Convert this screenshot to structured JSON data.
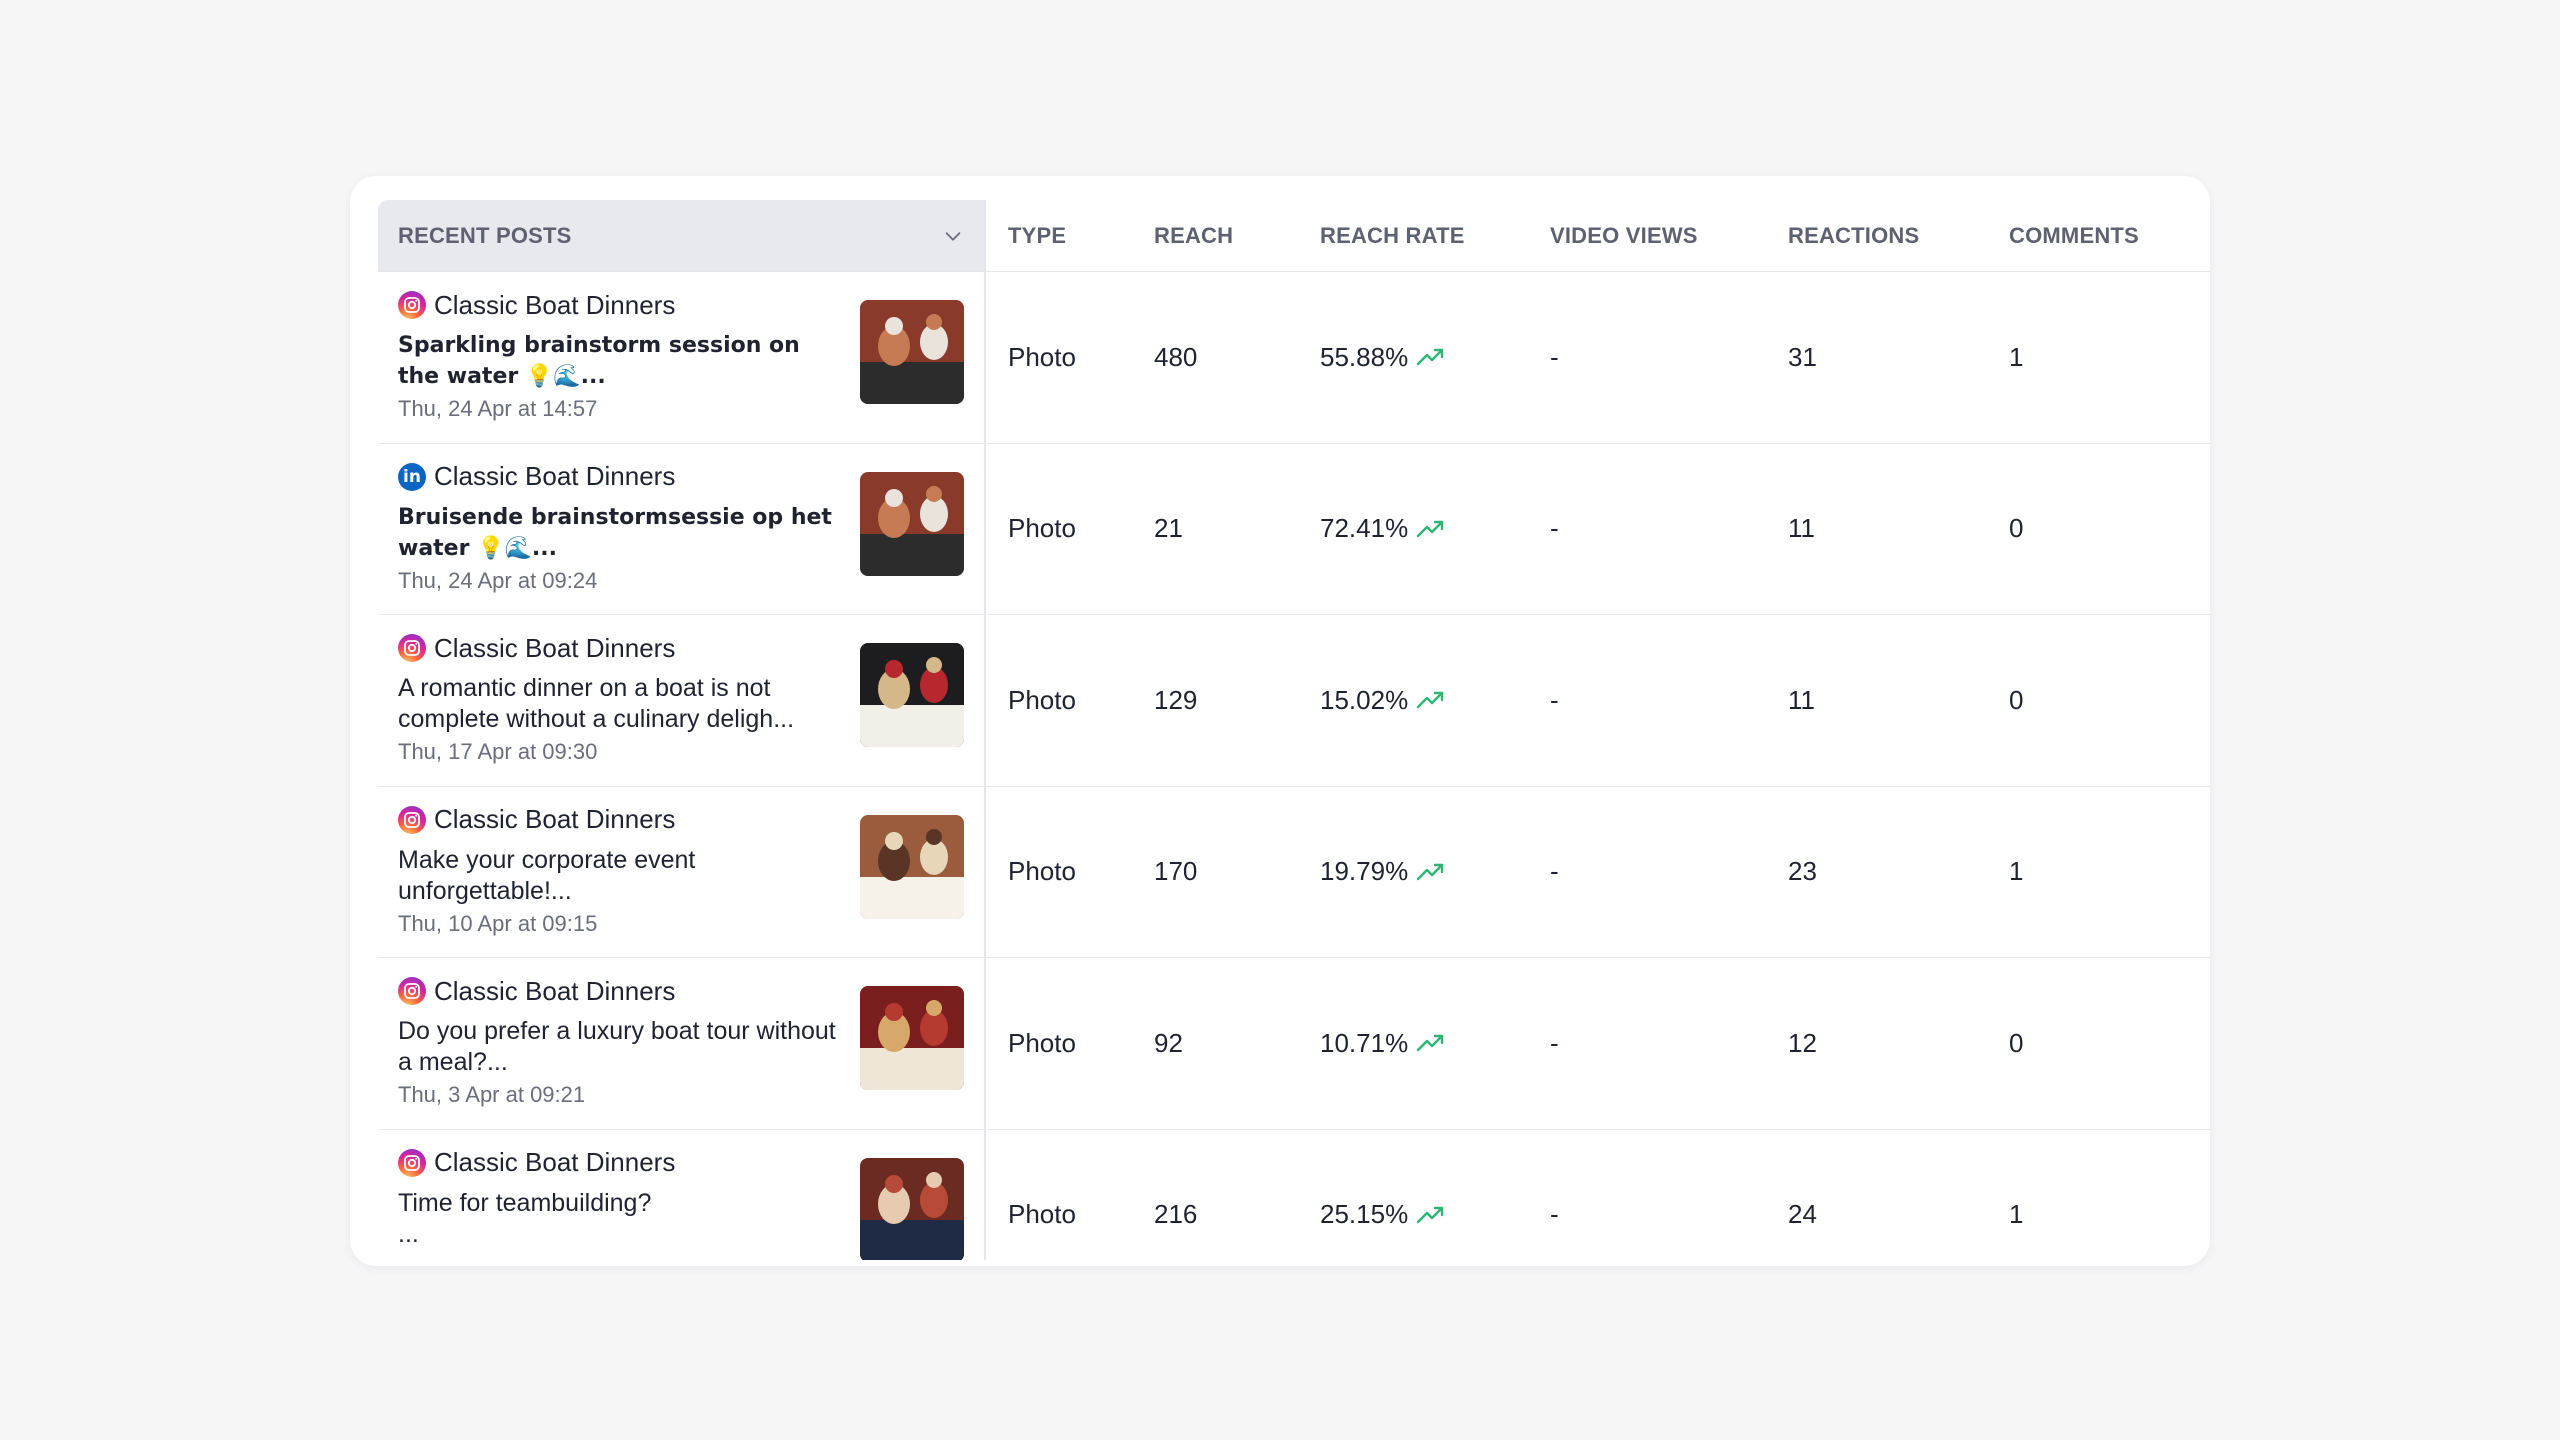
{
  "columns": [
    "RECENT POSTS",
    "TYPE",
    "REACH",
    "REACH RATE",
    "VIDEO VIEWS",
    "REACTIONS",
    "COMMENTS"
  ],
  "posts": [
    {
      "network": "instagram",
      "account": "Classic Boat Dinners",
      "message": "Sparkling brainstorm session on the water 💡🌊...",
      "bold": true,
      "date": "Thu, 24 Apr at 14:57",
      "type": "Photo",
      "reach": "480",
      "reach_rate": "55.88%",
      "video_views": "-",
      "reactions": "31",
      "comments": "1"
    },
    {
      "network": "linkedin",
      "account": "Classic Boat Dinners",
      "message": "Bruisende brainstormsessie op het water 💡🌊...",
      "bold": true,
      "date": "Thu, 24 Apr at 09:24",
      "type": "Photo",
      "reach": "21",
      "reach_rate": "72.41%",
      "video_views": "-",
      "reactions": "11",
      "comments": "0"
    },
    {
      "network": "instagram",
      "account": "Classic Boat Dinners",
      "message": "A romantic dinner on a boat is not complete without a culinary deligh...",
      "bold": false,
      "date": "Thu, 17 Apr at 09:30",
      "type": "Photo",
      "reach": "129",
      "reach_rate": "15.02%",
      "video_views": "-",
      "reactions": "11",
      "comments": "0"
    },
    {
      "network": "instagram",
      "account": "Classic Boat Dinners",
      "message": "Make your corporate event unforgettable!...",
      "bold": false,
      "date": "Thu, 10 Apr at 09:15",
      "type": "Photo",
      "reach": "170",
      "reach_rate": "19.79%",
      "video_views": "-",
      "reactions": "23",
      "comments": "1"
    },
    {
      "network": "instagram",
      "account": "Classic Boat Dinners",
      "message": "Do you prefer a luxury boat tour without a meal?...",
      "bold": false,
      "date": "Thu, 3 Apr at 09:21",
      "type": "Photo",
      "reach": "92",
      "reach_rate": "10.71%",
      "video_views": "-",
      "reactions": "12",
      "comments": "0"
    },
    {
      "network": "instagram",
      "account": "Classic Boat Dinners",
      "message": "Time for teambuilding?\n...",
      "bold": false,
      "date": "",
      "type": "Photo",
      "reach": "216",
      "reach_rate": "25.15%",
      "video_views": "-",
      "reactions": "24",
      "comments": "1"
    }
  ],
  "colors": {
    "trend_up": "#2bb673",
    "header_bg": "#e8e9ef",
    "linkedin": "#0a66c2"
  },
  "icons": {
    "sort": "chevron-down-icon",
    "trend": "trend-up-icon",
    "instagram": "instagram-icon",
    "linkedin": "linkedin-icon"
  }
}
